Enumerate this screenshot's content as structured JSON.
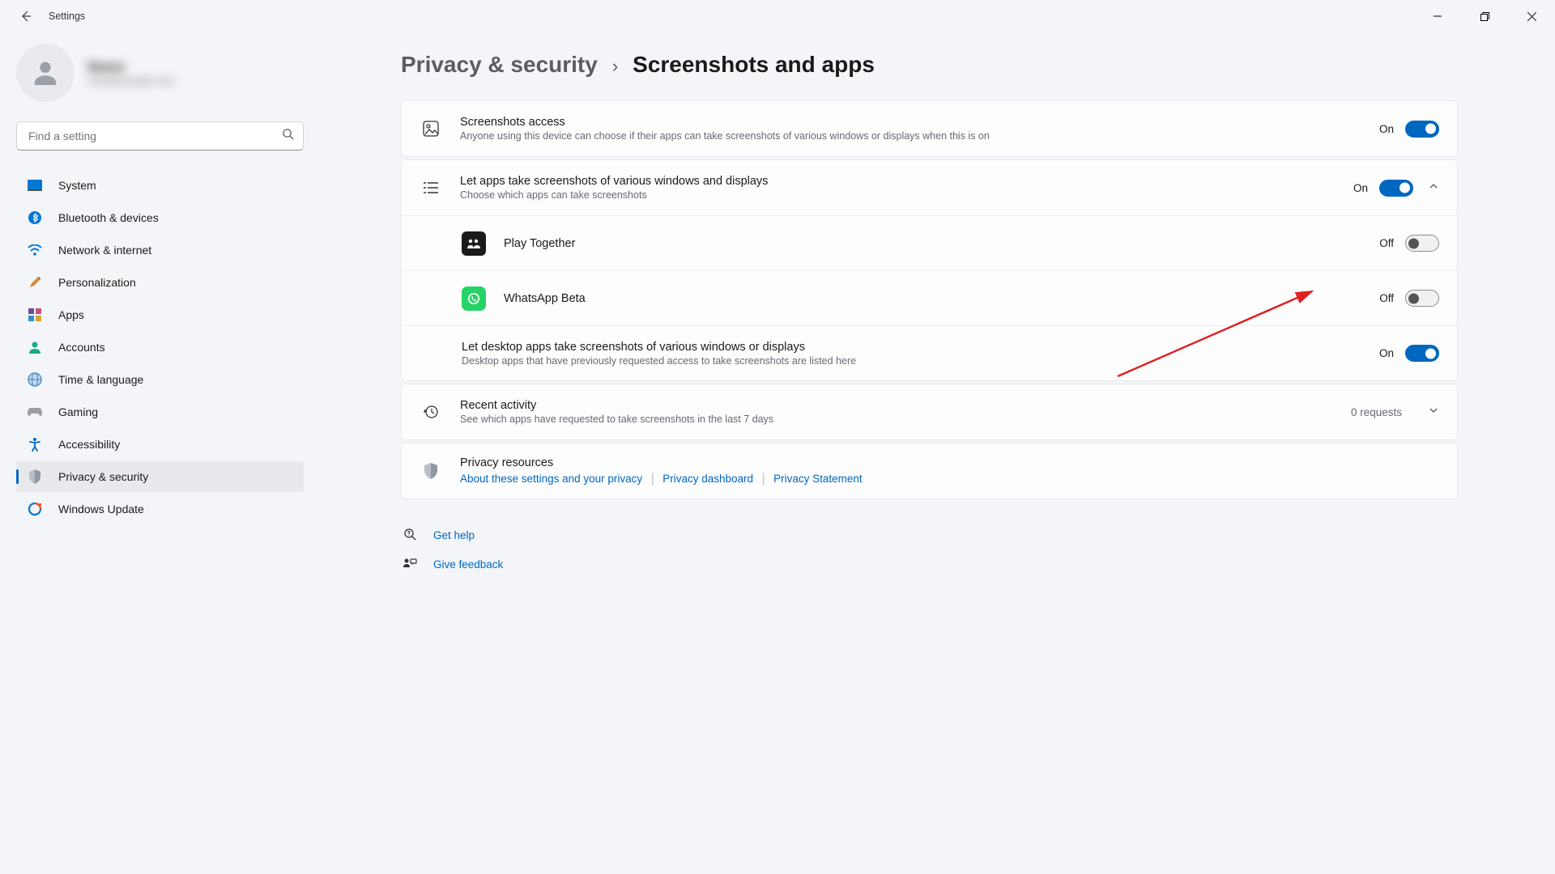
{
  "titlebar": {
    "title": "Settings"
  },
  "user": {
    "name": "Name",
    "email": "user@example.com"
  },
  "search": {
    "placeholder": "Find a setting"
  },
  "nav": {
    "items": [
      {
        "label": "System"
      },
      {
        "label": "Bluetooth & devices"
      },
      {
        "label": "Network & internet"
      },
      {
        "label": "Personalization"
      },
      {
        "label": "Apps"
      },
      {
        "label": "Accounts"
      },
      {
        "label": "Time & language"
      },
      {
        "label": "Gaming"
      },
      {
        "label": "Accessibility"
      },
      {
        "label": "Privacy & security"
      },
      {
        "label": "Windows Update"
      }
    ]
  },
  "breadcrumb": {
    "parent": "Privacy & security",
    "current": "Screenshots and apps"
  },
  "rows": {
    "access": {
      "title": "Screenshots access",
      "desc": "Anyone using this device can choose if their apps can take screenshots of various windows or displays when this is on",
      "state": "On"
    },
    "letApps": {
      "title": "Let apps take screenshots of various windows and displays",
      "desc": "Choose which apps can take screenshots",
      "state": "On"
    },
    "apps": [
      {
        "name": "Play Together",
        "state": "Off"
      },
      {
        "name": "WhatsApp Beta",
        "state": "Off"
      }
    ],
    "desktop": {
      "title": "Let desktop apps take screenshots of various windows or displays",
      "desc": "Desktop apps that have previously requested access to take screenshots are listed here",
      "state": "On"
    },
    "recent": {
      "title": "Recent activity",
      "desc": "See which apps have requested to take screenshots in the last 7 days",
      "count": "0 requests"
    },
    "resources": {
      "title": "Privacy resources",
      "links": [
        "About these settings and your privacy",
        "Privacy dashboard",
        "Privacy Statement"
      ]
    }
  },
  "footer": {
    "help": "Get help",
    "feedback": "Give feedback"
  }
}
